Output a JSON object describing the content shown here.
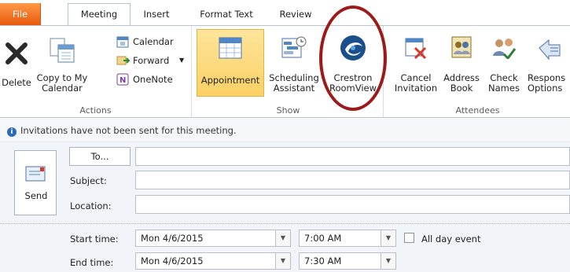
{
  "tabs": {
    "file": "File",
    "meeting": "Meeting",
    "insert": "Insert",
    "format_text": "Format Text",
    "review": "Review"
  },
  "actions": {
    "delete": "Delete",
    "copy_to_calendar": [
      "Copy to My",
      "Calendar"
    ],
    "calendar": "Calendar",
    "forward": "Forward",
    "onenote": "OneNote",
    "group_label": "Actions"
  },
  "show": {
    "appointment": "Appointment",
    "scheduling": [
      "Scheduling",
      "Assistant"
    ],
    "crestron": [
      "Crestron",
      "RoomView"
    ],
    "group_label": "Show"
  },
  "attendees": {
    "cancel": [
      "Cancel",
      "Invitation"
    ],
    "address_book": [
      "Address",
      "Book"
    ],
    "check_names": [
      "Check",
      "Names"
    ],
    "response": [
      "Respons",
      "Options"
    ],
    "group_label": "Attendees"
  },
  "info": "Invitations have not been sent for this meeting.",
  "form": {
    "send": "Send",
    "to": "To...",
    "subject": "Subject:",
    "location": "Location:",
    "start_time_label": "Start time:",
    "end_time_label": "End time:",
    "start_date": "Mon 4/6/2015",
    "start_time": "7:00 AM",
    "end_date": "Mon 4/6/2015",
    "end_time": "7:30 AM",
    "all_day": "All day event"
  },
  "icons": [
    "delete-icon",
    "copy-calendar-icon",
    "calendar-icon",
    "forward-icon",
    "onenote-icon",
    "appointment-icon",
    "scheduling-icon",
    "crestron-icon",
    "cancel-invitation-icon",
    "address-book-icon",
    "check-names-icon",
    "response-options-icon",
    "info-icon",
    "send-icon"
  ],
  "colors": {
    "file_tab": "#e8580c",
    "appointment_highlight": "#fcd36b",
    "annotation_circle": "#9c1a1a"
  }
}
